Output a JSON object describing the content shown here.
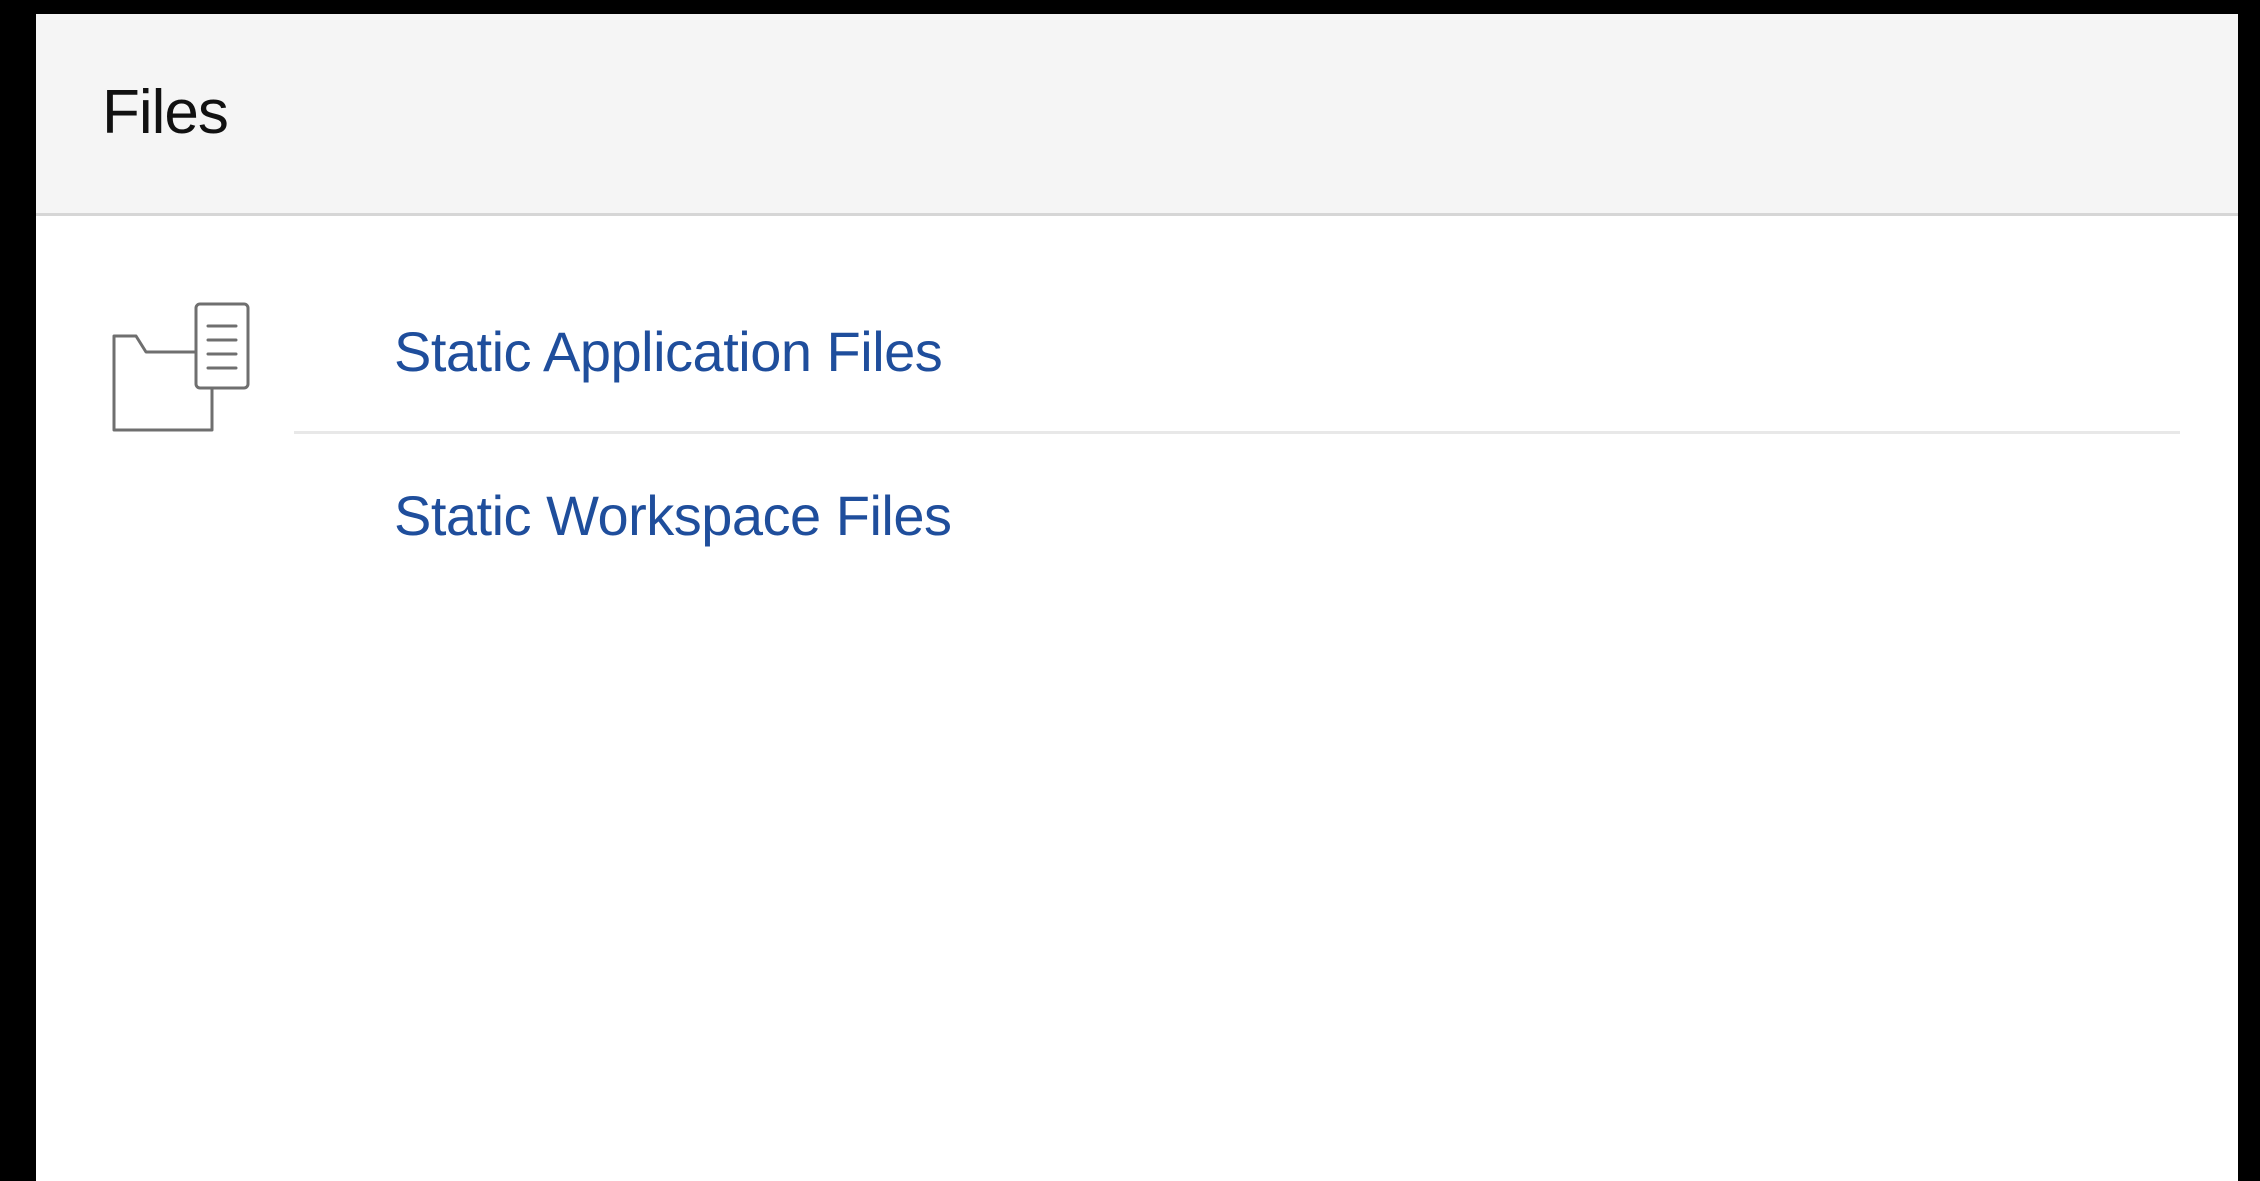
{
  "panel": {
    "title": "Files"
  },
  "icon": {
    "name": "files-folder-icon"
  },
  "links": [
    {
      "label": "Static Application Files"
    },
    {
      "label": "Static Workspace Files"
    }
  ],
  "colors": {
    "link": "#1f4e9c",
    "header_bg": "#f5f5f5",
    "divider": "#e8e8e8"
  }
}
